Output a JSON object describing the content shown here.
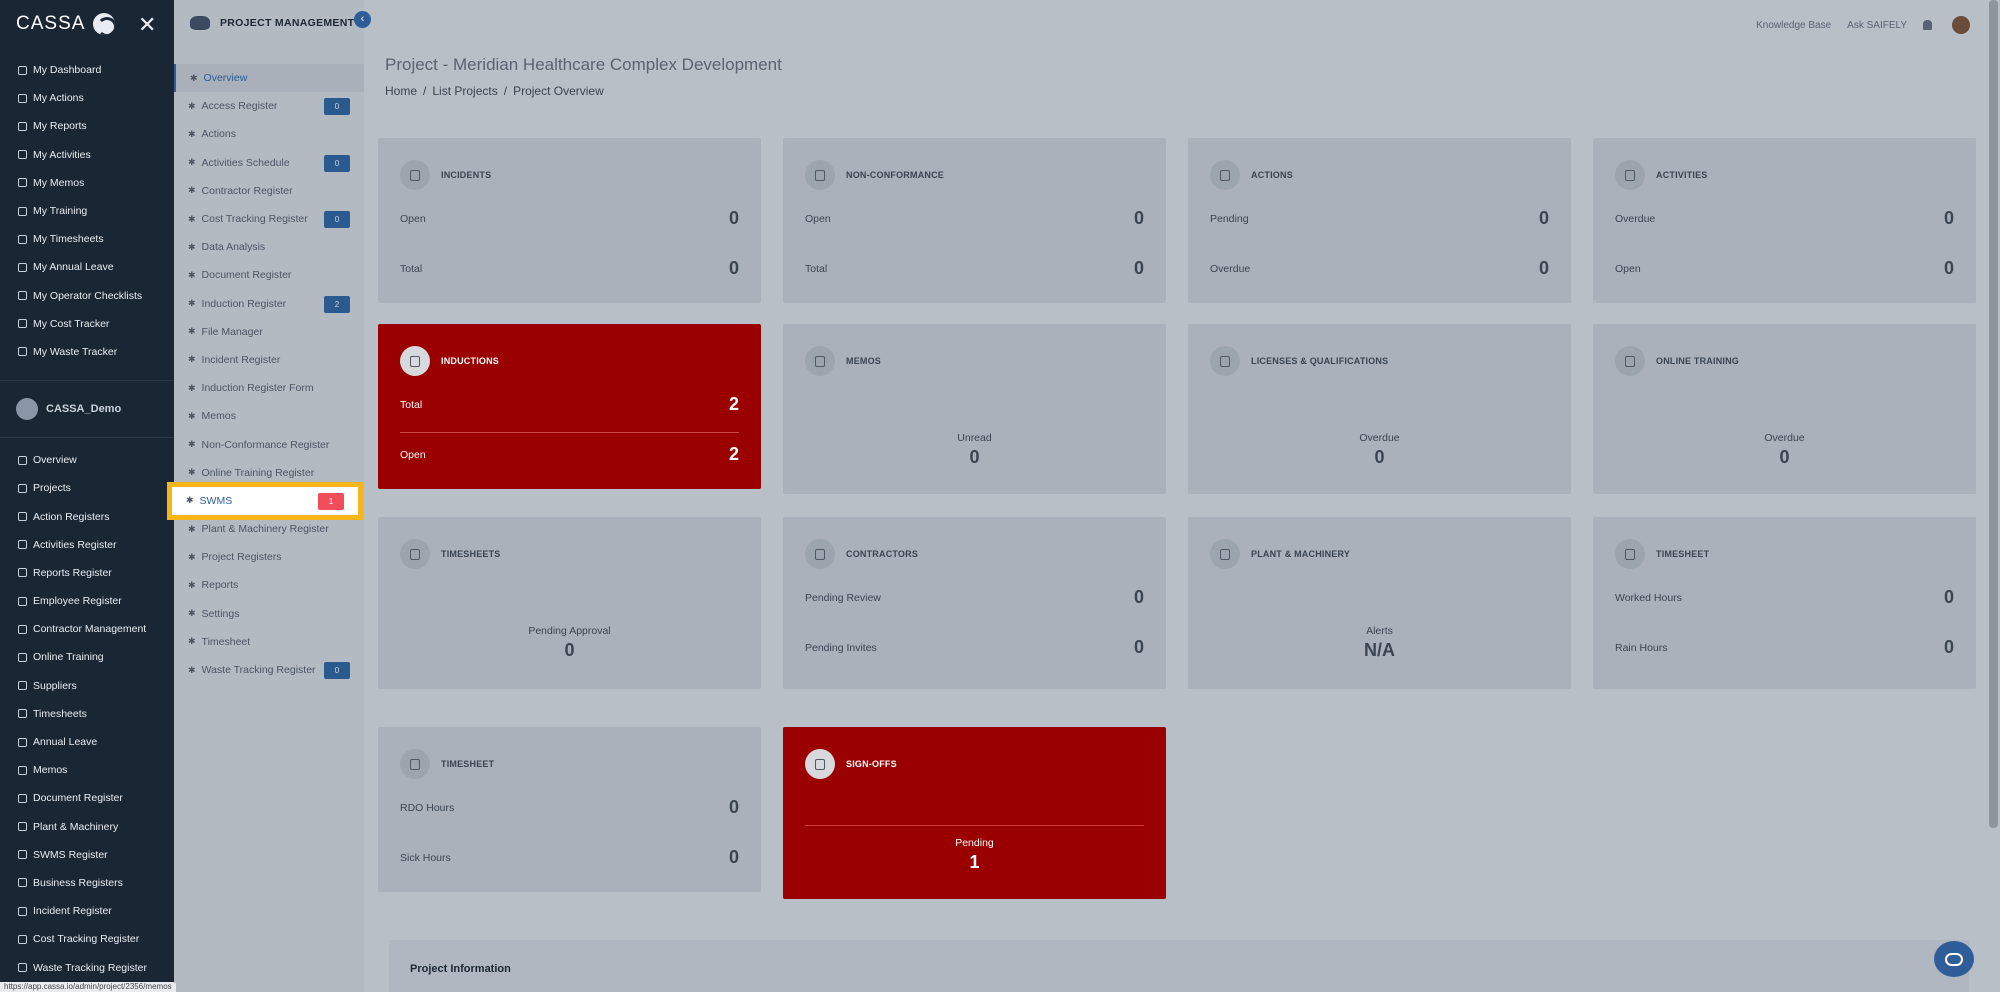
{
  "brand": "CASSA",
  "sidebar": {
    "personal": [
      "My Dashboard",
      "My Actions",
      "My Reports",
      "My Activities",
      "My Memos",
      "My Training",
      "My Timesheets",
      "My Annual Leave",
      "My Operator Checklists",
      "My Cost Tracker",
      "My Waste Tracker"
    ],
    "org_name": "CASSA_Demo",
    "org_items": [
      "Overview",
      "Projects",
      "Action Registers",
      "Activities Register",
      "Reports Register",
      "Employee Register",
      "Contractor Management",
      "Online Training",
      "Suppliers",
      "Timesheets",
      "Annual Leave",
      "Memos",
      "Document Register",
      "Plant & Machinery",
      "SWMS Register",
      "Business Registers",
      "Incident Register",
      "Cost Tracking Register",
      "Waste Tracking Register"
    ]
  },
  "panel": {
    "title": "PROJECT MANAGEMENT",
    "items": [
      {
        "label": "Overview",
        "count": ""
      },
      {
        "label": "Access Register",
        "count": "0"
      },
      {
        "label": "Actions",
        "count": ""
      },
      {
        "label": "Activities Schedule",
        "count": "0"
      },
      {
        "label": "Contractor Register",
        "count": ""
      },
      {
        "label": "Cost Tracking Register",
        "count": "0"
      },
      {
        "label": "Data Analysis",
        "count": ""
      },
      {
        "label": "Document Register",
        "count": ""
      },
      {
        "label": "Induction Register",
        "count": "2"
      },
      {
        "label": "File Manager",
        "count": ""
      },
      {
        "label": "Incident Register",
        "count": ""
      },
      {
        "label": "Induction Register Form",
        "count": ""
      },
      {
        "label": "Memos",
        "count": ""
      },
      {
        "label": "Non-Conformance Register",
        "count": ""
      },
      {
        "label": "Online Training Register",
        "count": ""
      },
      {
        "label": "SWMS",
        "count": "1"
      },
      {
        "label": "Plant & Machinery Register",
        "count": ""
      },
      {
        "label": "Project Registers",
        "count": ""
      },
      {
        "label": "Reports",
        "count": ""
      },
      {
        "label": "Settings",
        "count": ""
      },
      {
        "label": "Timesheet",
        "count": ""
      },
      {
        "label": "Waste Tracking Register",
        "count": "0"
      }
    ]
  },
  "header": {
    "knowledge_base": "Knowledge Base",
    "ask": "Ask SAIFELY"
  },
  "page": {
    "title": "Project - Meridian Healthcare Complex Development",
    "breadcrumb": [
      "Home",
      "List Projects",
      "Project Overview"
    ]
  },
  "cards": {
    "incidents": {
      "title": "INCIDENTS",
      "r1_label": "Open",
      "r1_value": "0",
      "r2_label": "Total",
      "r2_value": "0"
    },
    "nonconformance": {
      "title": "NON-CONFORMANCE",
      "r1_label": "Open",
      "r1_value": "0",
      "r2_label": "Total",
      "r2_value": "0"
    },
    "actions": {
      "title": "ACTIONS",
      "r1_label": "Pending",
      "r1_value": "0",
      "r2_label": "Overdue",
      "r2_value": "0"
    },
    "activities": {
      "title": "ACTIVITIES",
      "r1_label": "Overdue",
      "r1_value": "0",
      "r2_label": "Open",
      "r2_value": "0"
    },
    "inductions": {
      "title": "INDUCTIONS",
      "r1_label": "Total",
      "r1_value": "2",
      "r2_label": "Open",
      "r2_value": "2"
    },
    "memos": {
      "title": "MEMOS",
      "label": "Unread",
      "value": "0"
    },
    "licenses": {
      "title": "LICENSES & QUALIFICATIONS",
      "label": "Overdue",
      "value": "0"
    },
    "online_training": {
      "title": "ONLINE TRAINING",
      "label": "Overdue",
      "value": "0"
    },
    "timesheets": {
      "title": "TIMESHEETS",
      "label": "Pending Approval",
      "value": "0"
    },
    "contractors": {
      "title": "CONTRACTORS",
      "r1_label": "Pending Review",
      "r1_value": "0",
      "r2_label": "Pending Invites",
      "r2_value": "0"
    },
    "plant": {
      "title": "PLANT & MACHINERY",
      "label": "Alerts",
      "value": "N/A"
    },
    "timesheet1": {
      "title": "TIMESHEET",
      "r1_label": "Worked Hours",
      "r1_value": "0",
      "r2_label": "Rain Hours",
      "r2_value": "0"
    },
    "timesheet2": {
      "title": "TIMESHEET",
      "r1_label": "RDO Hours",
      "r1_value": "0",
      "r2_label": "Sick Hours",
      "r2_value": "0"
    },
    "signoffs": {
      "title": "SIGN-OFFS",
      "label": "Pending",
      "value": "1"
    }
  },
  "info": {
    "title": "Project Information"
  },
  "status_url": "https://app.cassa.io/admin/project/2356/memos"
}
